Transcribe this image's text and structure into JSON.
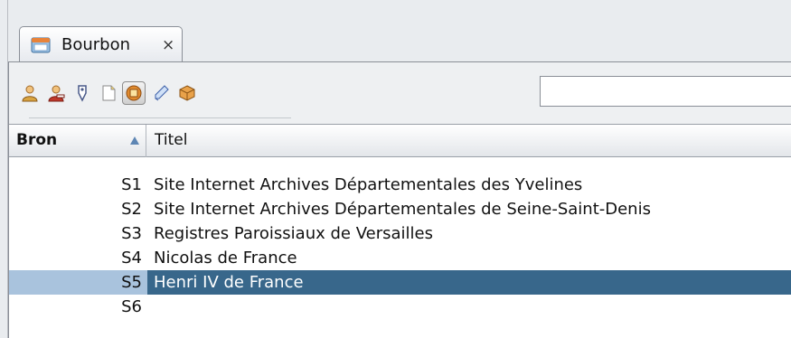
{
  "tab": {
    "label": "Bourbon",
    "close_glyph": "×",
    "icon": "window-icon"
  },
  "toolbar": {
    "buttons": [
      {
        "name": "person-icon",
        "color": "#d9a441"
      },
      {
        "name": "person-remove-icon",
        "color": "#c0392b"
      },
      {
        "name": "tag-icon",
        "color": "#6c7aa8"
      },
      {
        "name": "note-icon",
        "color": "#f4d36b"
      },
      {
        "name": "source-icon",
        "color": "#e08a2e",
        "active": true
      },
      {
        "name": "edit-icon",
        "color": "#5b7cc4"
      },
      {
        "name": "box-icon",
        "color": "#d98b2a"
      }
    ],
    "search_value": ""
  },
  "table": {
    "columns": {
      "bron": "Bron",
      "titel": "Titel"
    },
    "sort": "ascending",
    "rows": [
      {
        "id": "S1",
        "title": "Site Internet Archives Départementales des Yvelines"
      },
      {
        "id": "S2",
        "title": "Site Internet Archives Départementales de Seine-Saint-Denis"
      },
      {
        "id": "S3",
        "title": "Registres Paroissiaux de Versailles"
      },
      {
        "id": "S4",
        "title": "Nicolas de France"
      },
      {
        "id": "S5",
        "title": "Henri IV de France",
        "selected": true
      },
      {
        "id": "S6",
        "title": ""
      }
    ]
  },
  "colors": {
    "selection": "#38678b",
    "selection_light": "#a9c3dd",
    "background": "#e9ecef"
  }
}
